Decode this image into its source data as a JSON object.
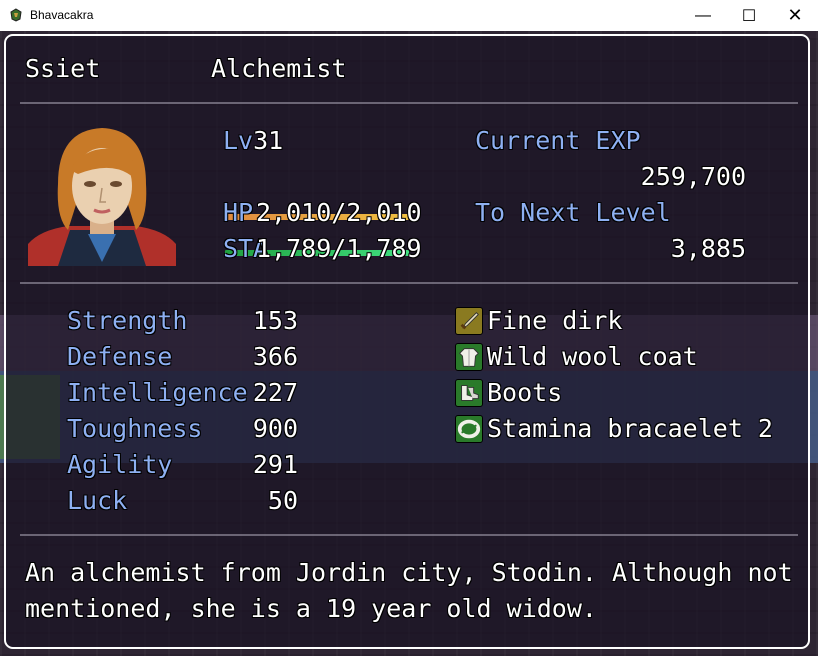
{
  "window": {
    "title": "Bhavacakra",
    "minimize_glyph": "—",
    "maximize_glyph": "☐",
    "close_glyph": "✕"
  },
  "actor": {
    "name": "Ssiet",
    "class": "Alchemist",
    "level_label": "Lv",
    "level": "31",
    "hp_label": "HP",
    "hp_value": "2,010/2,010",
    "hp_fraction": 1.0,
    "sta_label": "STA",
    "sta_value": "1,789/1,789",
    "sta_fraction": 1.0,
    "current_exp_label": "Current EXP",
    "current_exp": "259,700",
    "next_level_label": "To Next Level",
    "next_level": "3,885"
  },
  "params": [
    {
      "label": "Strength",
      "value": "153"
    },
    {
      "label": "Defense",
      "value": "366"
    },
    {
      "label": "Intelligence",
      "value": "227"
    },
    {
      "label": "Toughness",
      "value": "900"
    },
    {
      "label": "Agility",
      "value": "291"
    },
    {
      "label": "Luck",
      "value": "50"
    }
  ],
  "equipment": [
    {
      "name": "Fine dirk",
      "icon": "dagger-icon"
    },
    {
      "name": "Wild wool coat",
      "icon": "coat-icon"
    },
    {
      "name": "Boots",
      "icon": "boots-icon"
    },
    {
      "name": "Stamina bracaelet 2",
      "icon": "bracelet-icon"
    }
  ],
  "profile": {
    "line1": "An alchemist from Jordin city, Stodin. Although not",
    "line2": "mentioned, she is a 19 year old widow."
  },
  "colors": {
    "system_text": "#8eb0f2",
    "hp_gauge_start": "#e08a40",
    "hp_gauge_end": "#f0c040",
    "sta_gauge_start": "#20a040",
    "sta_gauge_end": "#40e080"
  }
}
